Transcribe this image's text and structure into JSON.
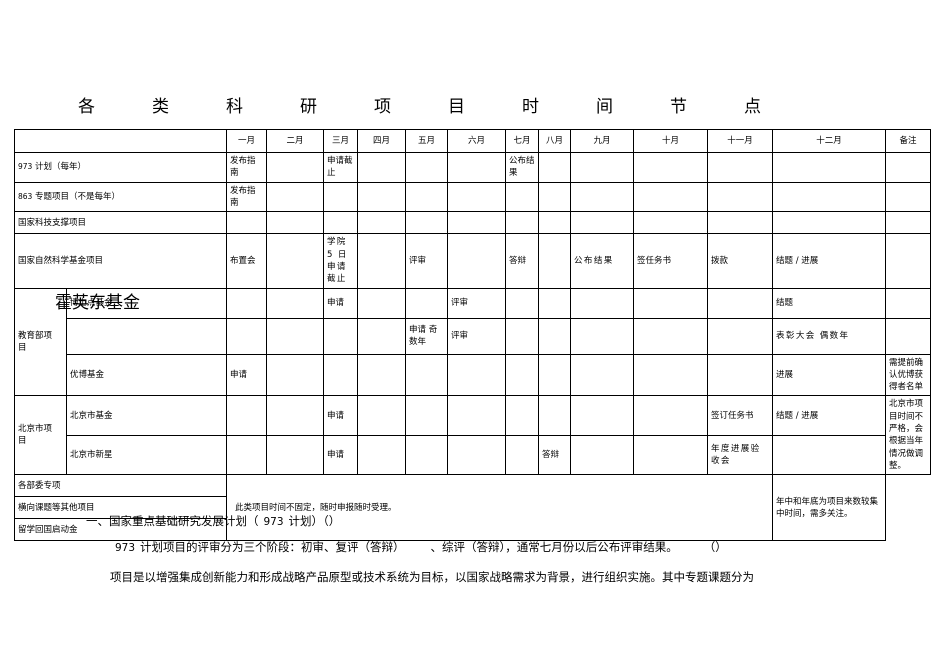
{
  "document": {
    "title_chars": [
      "各",
      "类",
      "科",
      "研",
      "项",
      "目",
      "时",
      "间",
      "节",
      "点"
    ],
    "title_plain": "各类科研项目时间节点"
  },
  "table": {
    "headers": [
      "",
      "一月",
      "二月",
      "三月",
      "四月",
      "五月",
      "六月",
      "七月",
      "八月",
      "九月",
      "十月",
      "十一月",
      "十二月",
      "备注"
    ],
    "rows": [
      {
        "name": "973 计划（每年）",
        "name_num": "973",
        "name_rest": "计划（每年）",
        "cells": [
          "发布指南",
          "",
          "申请截止",
          "",
          "",
          "",
          "公布结果",
          "",
          "",
          "",
          "",
          "",
          ""
        ]
      },
      {
        "name": "863 专题项目（不是每年）",
        "name_num": "863",
        "name_rest": "专题项目（不是每年）",
        "cells": [
          "发布指南",
          "",
          "",
          "",
          "",
          "",
          "",
          "",
          "",
          "",
          "",
          "",
          ""
        ]
      },
      {
        "name": "国家科技支撑项目",
        "cells": [
          "",
          "",
          "",
          "",
          "",
          "",
          "",
          "",
          "",
          "",
          "",
          "",
          ""
        ]
      },
      {
        "name": "国家自然科学基金项目",
        "cells": [
          "布置会",
          "",
          "学院 5 日申请截止",
          "",
          "评审",
          "",
          "答辩",
          "",
          "公布结果",
          "签任务书",
          "拨款",
          "结题 / 进展",
          ""
        ]
      },
      {
        "group": "教育部项目",
        "group_overlay": "霍英东基金",
        "name": "博士点基金",
        "cells": [
          "",
          "",
          "申请",
          "",
          "",
          "评审",
          "",
          "",
          "",
          "",
          "",
          "结题",
          ""
        ]
      },
      {
        "name": "霍英东基金",
        "cells": [
          "",
          "",
          "",
          "",
          "申请 奇数年",
          "评审",
          "",
          "",
          "",
          "",
          "",
          "表彰大会 偶数年",
          ""
        ]
      },
      {
        "name": "优博基金",
        "cells": [
          "申请",
          "",
          "",
          "",
          "",
          "",
          "",
          "",
          "",
          "",
          "",
          "进展",
          "需提前确认优博获得者名单"
        ]
      },
      {
        "group": "北京市项目",
        "name": "北京市基金",
        "cells": [
          "",
          "",
          "申请",
          "",
          "",
          "",
          "",
          "",
          "",
          "",
          "签订任务书",
          "结题 / 进展",
          "北京市项目时间不严格，会根据当年情况做调整。"
        ]
      },
      {
        "name": "北京市新星",
        "cells": [
          "",
          "",
          "申请",
          "",
          "",
          "",
          "",
          "答辩",
          "",
          "",
          "年度进展验收会",
          "",
          ""
        ]
      },
      {
        "name": "各部委专项",
        "merged_note": "此类项目时间不固定，随时申报随时受理。",
        "merged_remark": "年中和年底为项目来数较集中时间，需多关注。"
      },
      {
        "name": "横向课题等其他项目"
      },
      {
        "name": "留学回国启动金"
      }
    ]
  },
  "body_text": {
    "heading_1": "一、国家重点基础研究发展计划（",
    "heading_1_num": "973",
    "heading_1_tail": "计划）（）",
    "para_2_num": "973",
    "para_2": "计划项目的评审分为三个阶段：初审、复评（答辩）",
    "para_2_mid": "、综评（答辩），通常七月份以后公布评审结果。",
    "para_2_tail": "（）",
    "para_3": "项目是以增强集成创新能力和形成战略产品原型或技术系统为目标，以国家战略需求为背景，进行组织实施。其中专题课题分为"
  }
}
